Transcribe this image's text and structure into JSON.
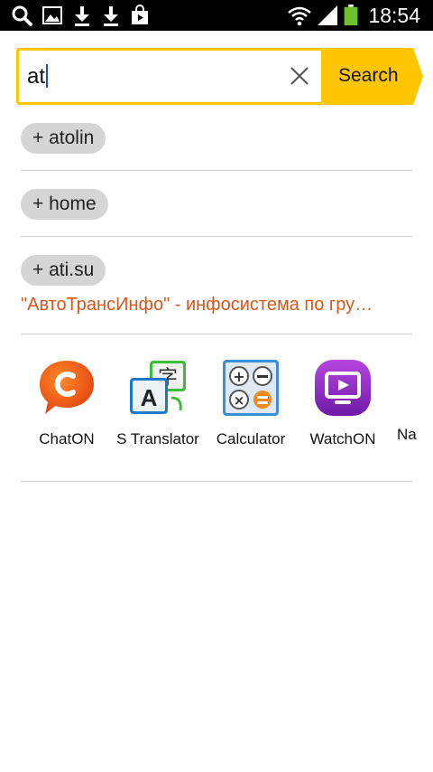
{
  "status_bar": {
    "time": "18:54",
    "icons": [
      "search-icon",
      "gallery-icon",
      "download-icon",
      "download-icon",
      "shop-bag-icon",
      "wifi-icon",
      "signal-icon",
      "battery-icon"
    ]
  },
  "search": {
    "value": "at",
    "button_label": "Search",
    "accent_color": "#ffc600"
  },
  "suggestions": [
    {
      "label": "+ atolin"
    },
    {
      "label": "+ home"
    },
    {
      "label": "+ ati.su",
      "link_text": "\"АвтоТрансИнфо\" - инфосистема по гру…",
      "link_color": "#d9561a"
    }
  ],
  "apps": [
    {
      "name": "ChatON",
      "icon": "chaton-icon"
    },
    {
      "name": "S Translator",
      "icon": "translator-icon"
    },
    {
      "name": "Calculator",
      "icon": "calculator-icon"
    },
    {
      "name": "WatchON",
      "icon": "watchon-icon"
    },
    {
      "name": "Na",
      "icon": "partial-app-label"
    }
  ]
}
